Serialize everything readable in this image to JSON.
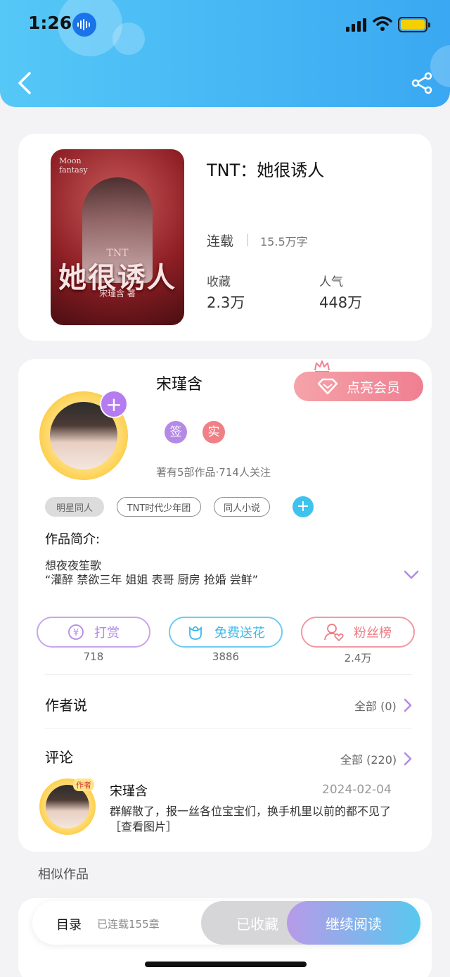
{
  "status": {
    "time": "1:26"
  },
  "book": {
    "title": "TNT：她很诱人",
    "status": "连载",
    "words": "15.5万字",
    "fav_label": "收藏",
    "fav_value": "2.3万",
    "pop_label": "人气",
    "pop_value": "448万",
    "cover": {
      "top_text": "Moon\nfantasy",
      "tnt": "TNT",
      "title": "她很诱人",
      "author": "宋瑾含 著"
    }
  },
  "author": {
    "name": "宋瑾含",
    "vip_button": "点亮会员",
    "badge_sign": "签",
    "badge_real": "实",
    "stats": "著有5部作品·714人关注",
    "tags": [
      "明星同人",
      "TNT时代少年团",
      "同人小说"
    ]
  },
  "intro": {
    "label": "作品简介:",
    "line1": "想夜夜笙歌",
    "line2": "“灌醉 禁欲三年 姐姐 表哥 厨房 抢婚 尝鲜”"
  },
  "actions": [
    {
      "label": "打赏",
      "count": "718",
      "color": "#b48ae6"
    },
    {
      "label": "免费送花",
      "count": "3886",
      "color": "#4cc2ee"
    },
    {
      "label": "粉丝榜",
      "count": "2.4万",
      "color": "#ee7a82"
    }
  ],
  "author_says": {
    "title": "作者说",
    "all": "全部 (0)"
  },
  "comments": {
    "title": "评论",
    "all": "全部 (220)",
    "item": {
      "user": "宋瑾含",
      "badge": "作者",
      "date": "2024-02-04",
      "text": "群解散了，报一丝各位宝宝们，换手机里以前的都不见了［查看图片］"
    }
  },
  "similar": {
    "title": "相似作品"
  },
  "bottom_bar": {
    "toc": "目录",
    "chapters": "已连载155章",
    "collected": "已收藏",
    "continue": "继续阅读"
  }
}
